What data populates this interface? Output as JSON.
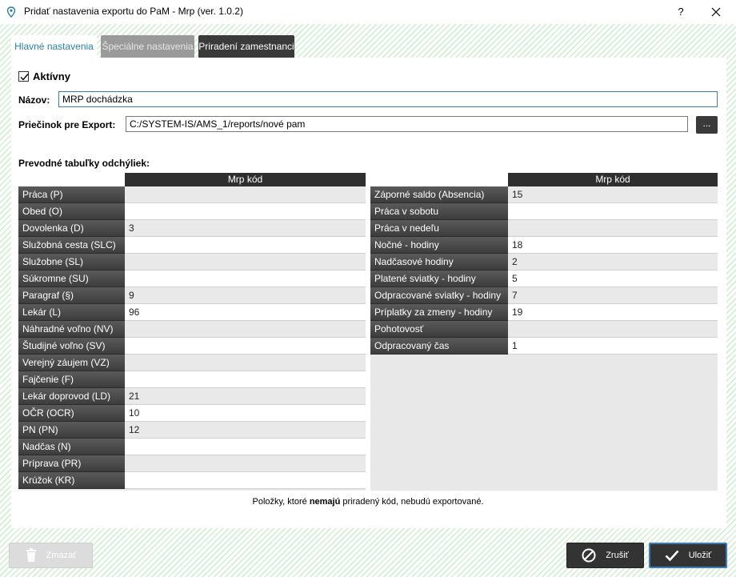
{
  "window": {
    "title": "Pridať nastavenia exportu do PaM - Mrp (ver. 1.0.2)",
    "help_label": "?",
    "close_label": "✕"
  },
  "tabs": [
    {
      "label": "Hlavné nastavenia",
      "active": true
    },
    {
      "label": "Špeciálne nastavenia",
      "active": false
    },
    {
      "label": "Priradení zamestnanci",
      "active": false
    }
  ],
  "form": {
    "active_label": "Aktívny",
    "active_checked": true,
    "name_label": "Názov:",
    "name_value": "MRP dochádzka",
    "folder_label": "Priečinok pre Export:",
    "folder_value": "C:/SYSTEM-IS/AMS_1/reports/nové pam",
    "browse_label": "..."
  },
  "tables": {
    "section_title": "Prevodné tabuľky odchýliek:",
    "column_header": "Mrp kód",
    "left": [
      {
        "name": "Práca   (P)",
        "code": ""
      },
      {
        "name": "Obed   (O)",
        "code": ""
      },
      {
        "name": "Dovolenka   (D)",
        "code": "3"
      },
      {
        "name": "Služobná cesta   (SLC)",
        "code": ""
      },
      {
        "name": "Služobne   (SL)",
        "code": ""
      },
      {
        "name": "Súkromne   (SU)",
        "code": ""
      },
      {
        "name": "Paragraf   (§)",
        "code": "9"
      },
      {
        "name": "Lekár   (L)",
        "code": "96"
      },
      {
        "name": "Náhradné voľno   (NV)",
        "code": ""
      },
      {
        "name": "Študijné voľno   (SV)",
        "code": ""
      },
      {
        "name": "Verejný záujem   (VZ)",
        "code": ""
      },
      {
        "name": "Fajčenie   (F)",
        "code": ""
      },
      {
        "name": "Lekár doprovod   (LD)",
        "code": "21"
      },
      {
        "name": "OČR   (OCR)",
        "code": "10"
      },
      {
        "name": "PN   (PN)",
        "code": "12"
      },
      {
        "name": "Nadčas   (N)",
        "code": ""
      },
      {
        "name": "Príprava   (PR)",
        "code": ""
      },
      {
        "name": "Krúžok   (KR)",
        "code": ""
      }
    ],
    "right": [
      {
        "name": "Záporné saldo (Absencia)",
        "code": "15"
      },
      {
        "name": "Práca v sobotu",
        "code": ""
      },
      {
        "name": "Práca v nedeľu",
        "code": ""
      },
      {
        "name": "Nočné - hodiny",
        "code": "18"
      },
      {
        "name": "Nadčasové hodiny",
        "code": "2"
      },
      {
        "name": "Platené sviatky - hodiny",
        "code": "5"
      },
      {
        "name": "Odpracované sviatky - hodiny",
        "code": "7"
      },
      {
        "name": "Príplatky za zmeny - hodiny",
        "code": "19"
      },
      {
        "name": "Pohotovosť",
        "code": ""
      },
      {
        "name": "Odpracovaný čas",
        "code": "1"
      }
    ]
  },
  "note": {
    "before": "Položky, ktoré ",
    "bold": "nemajú",
    "after": " priradený kód, nebudú exportované."
  },
  "buttons": {
    "delete_label": "Zmazať",
    "cancel_label": "Zrušiť",
    "save_label": "Uložiť"
  },
  "icons": {
    "app": "location-pin-icon",
    "delete": "trash-icon",
    "cancel": "cancel-circle-icon",
    "save": "checkmark-icon"
  },
  "colors": {
    "accent": "#3d7ab8",
    "dark_button": "#333333",
    "active_tab_text": "#2a7fa6",
    "background_stripe": "#d9efd9"
  }
}
